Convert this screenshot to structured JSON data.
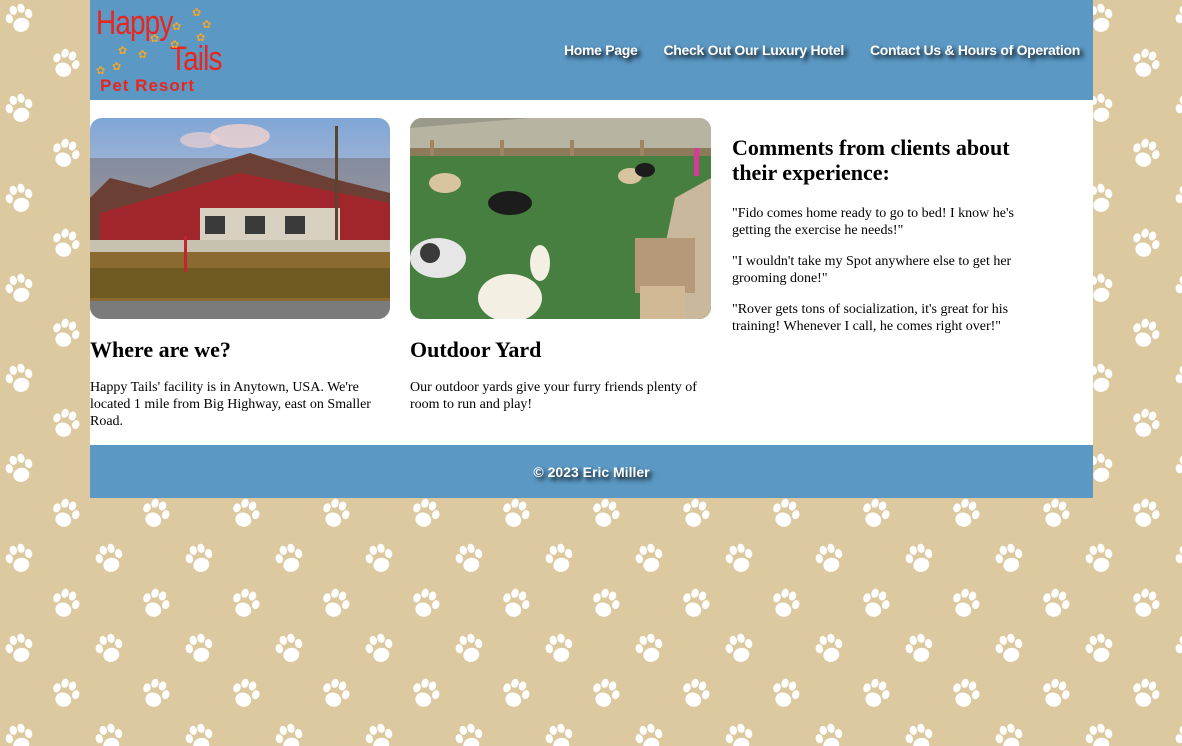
{
  "brand": {
    "line1": "Happy",
    "line2": "Tails",
    "line3": "Pet Resort"
  },
  "nav": {
    "home": "Home Page",
    "hotel": "Check Out Our Luxury Hotel",
    "contact": "Contact Us & Hours of Operation"
  },
  "sections": {
    "where": {
      "image_alt": "Happy Tails facility building",
      "heading": "Where are we?",
      "text": "Happy Tails' facility is in Anytown, USA. We're located 1 mile from Big Highway, east on Smaller Road."
    },
    "yard": {
      "image_alt": "Dogs playing in outdoor yard",
      "heading": "Outdoor Yard",
      "text": "Our outdoor yards give your furry friends plenty of room to run and play!"
    },
    "comments": {
      "heading": "Comments from clients about their experience:",
      "quotes": [
        "\"Fido comes home ready to go to bed! I know he's getting the exercise he needs!\"",
        "\"I wouldn't take my Spot anywhere else to get her grooming done!\"",
        "\"Rover gets tons of socialization, it's great for his training! Whenever I call, he comes right over!\""
      ]
    }
  },
  "footer": {
    "text": "© 2023 Eric Miller"
  },
  "colors": {
    "background": "#dcc9a0",
    "header": "#5b98c4",
    "logo_red": "#e8261d",
    "logo_paw": "#f2a52a"
  },
  "icons": {
    "background_pattern": "paw-print-icon"
  }
}
